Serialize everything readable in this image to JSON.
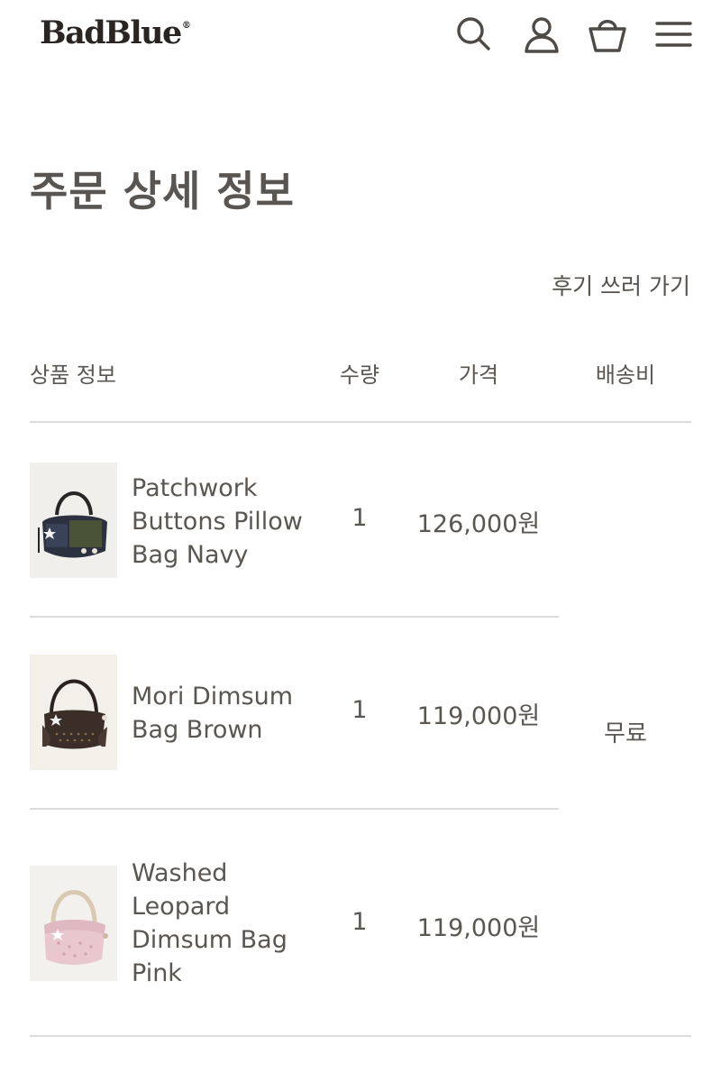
{
  "header": {
    "logo": "BadBlue",
    "logo_mark": "®",
    "icons": [
      "search-icon",
      "user-icon",
      "shopping-bag-icon",
      "menu-icon"
    ]
  },
  "page": {
    "title": "주문 상세 정보",
    "review_link": "후기 쓰러 가기"
  },
  "table": {
    "headers": {
      "product": "상품 정보",
      "quantity": "수량",
      "price": "가격",
      "shipping": "배송비"
    },
    "items": [
      {
        "name": "Patchwork Buttons Pillow Bag Navy",
        "quantity": "1",
        "price": "126,000원"
      },
      {
        "name": "Mori Dimsum Bag Brown",
        "quantity": "1",
        "price": "119,000원"
      },
      {
        "name": "Washed Leopard Dimsum Bag Pink",
        "quantity": "1",
        "price": "119,000원"
      }
    ],
    "shipping_fee": "무료"
  },
  "colors": {
    "text": "#5a5652",
    "logo": "#2a2523",
    "divider": "#dcdcdc",
    "thumb_background": "#f4f1ec"
  }
}
